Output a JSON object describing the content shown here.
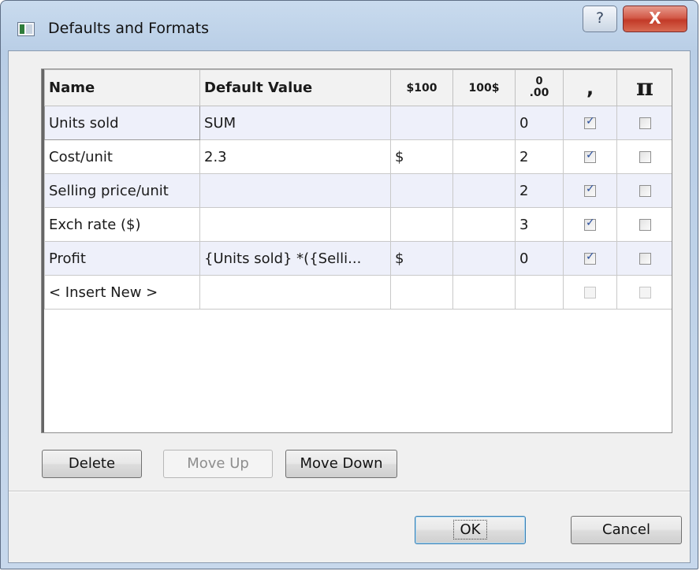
{
  "window": {
    "title": "Defaults and Formats",
    "help_glyph": "?",
    "close_glyph": "X"
  },
  "table": {
    "columns": [
      "Name",
      "Default Value",
      "$100",
      "100$",
      ".00",
      ",",
      "π"
    ],
    "column_decimals_top": "0",
    "rows": [
      {
        "name": "Units sold",
        "default": "SUM",
        "prefix": "",
        "suffix": "",
        "decimals": "0",
        "comma": true,
        "pi": false
      },
      {
        "name": "Cost/unit",
        "default": "2.3",
        "prefix": "$",
        "suffix": "",
        "decimals": "2",
        "comma": true,
        "pi": false
      },
      {
        "name": "Selling price/unit",
        "default": "",
        "prefix": "",
        "suffix": "",
        "decimals": "2",
        "comma": true,
        "pi": false
      },
      {
        "name": "Exch rate ($)",
        "default": "",
        "prefix": "",
        "suffix": "",
        "decimals": "3",
        "comma": true,
        "pi": false
      },
      {
        "name": "Profit",
        "default": "{Units sold} *({Selli...",
        "prefix": "$",
        "suffix": "",
        "decimals": "0",
        "comma": true,
        "pi": false
      },
      {
        "name": "< Insert New >",
        "default": "",
        "prefix": "",
        "suffix": "",
        "decimals": "",
        "comma": false,
        "pi": false
      }
    ]
  },
  "buttons": {
    "delete": "Delete",
    "move_up": "Move Up",
    "move_down": "Move Down",
    "ok": "OK",
    "cancel": "Cancel"
  }
}
